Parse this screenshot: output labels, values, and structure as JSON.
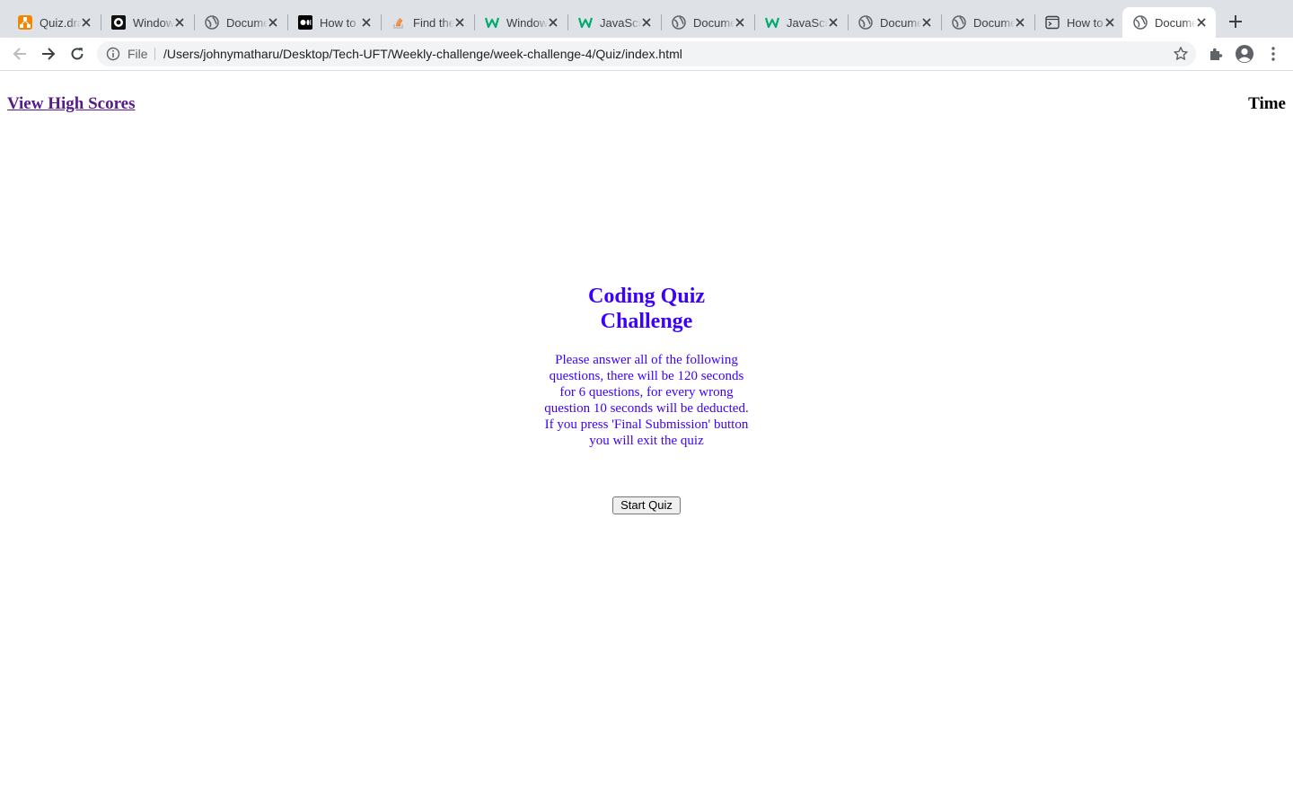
{
  "browser": {
    "tabs": [
      {
        "title": "Quiz.drawio",
        "icon": "drawio-icon",
        "active": false
      },
      {
        "title": "Window",
        "icon": "github-icon",
        "active": false
      },
      {
        "title": "Document",
        "icon": "globe-icon",
        "active": false
      },
      {
        "title": "How to",
        "icon": "medium-icon",
        "active": false
      },
      {
        "title": "Find the",
        "icon": "stackoverflow-icon",
        "active": false
      },
      {
        "title": "Window",
        "icon": "w3schools-icon",
        "active": false
      },
      {
        "title": "JavaScript",
        "icon": "w3schools-icon",
        "active": false
      },
      {
        "title": "Document",
        "icon": "globe-icon",
        "active": false
      },
      {
        "title": "JavaScript",
        "icon": "w3schools-icon",
        "active": false
      },
      {
        "title": "Document",
        "icon": "globe-icon",
        "active": false
      },
      {
        "title": "Document",
        "icon": "globe-icon",
        "active": false
      },
      {
        "title": "How to",
        "icon": "terminal-window-icon",
        "active": false
      },
      {
        "title": "Document",
        "icon": "globe-icon",
        "active": true
      }
    ],
    "address": {
      "scheme_label": "File",
      "url": "/Users/johnymatharu/Desktop/Tech-UFT/Weekly-challenge/week-challenge-4/Quiz/index.html"
    }
  },
  "page": {
    "highscores_link": "View High Scores",
    "timer_label": "Time",
    "quiz_title": "Coding Quiz Challenge",
    "quiz_instructions": "Please answer all of the following questions, there will be 120 seconds for 6 questions, for every wrong question 10 seconds will be deducted. If you press 'Final Submission' button you will exit the quiz",
    "start_button": "Start Quiz"
  },
  "colors": {
    "quiz_text": "#3b00ff",
    "visited_link": "#551a8b",
    "tabstrip": "#dee1e6"
  }
}
